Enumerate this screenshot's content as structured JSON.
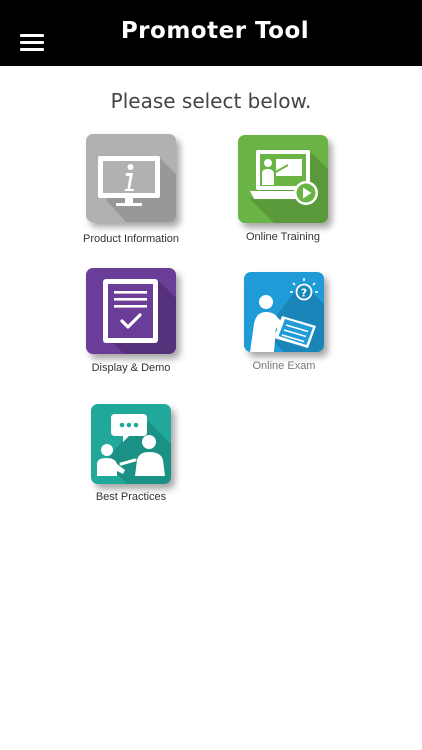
{
  "header": {
    "title": "Promoter Tool",
    "menu_icon": "hamburger-icon"
  },
  "prompt": "Please select below.",
  "colors": {
    "header_bg": "#000000",
    "product_information": "#b1b1b3",
    "online_training": "#6ab445",
    "display_demo": "#6a3d98",
    "online_exam": "#1f9bd7",
    "best_practices": "#20a89a"
  },
  "tiles": [
    {
      "label": "Product Information",
      "icon": "info-monitor-icon"
    },
    {
      "label": "Online Training",
      "icon": "training-laptop-icon"
    },
    {
      "label": "Display & Demo",
      "icon": "checklist-tablet-icon"
    },
    {
      "label": "Online Exam",
      "icon": "exam-writing-icon"
    },
    {
      "label": "Best Practices",
      "icon": "discussion-people-icon"
    }
  ]
}
